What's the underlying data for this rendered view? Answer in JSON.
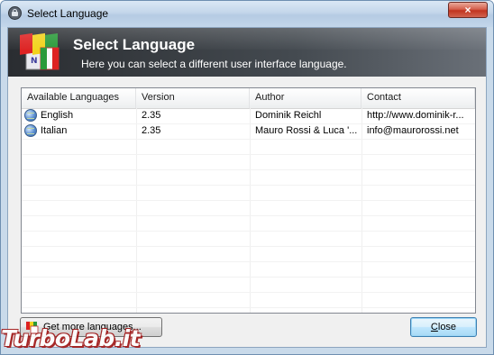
{
  "window": {
    "title": "Select Language",
    "close_glyph": "×"
  },
  "banner": {
    "title": "Select Language",
    "subtitle": "Here you can select a different user interface language.",
    "icon": "language-flags-icon"
  },
  "list": {
    "columns": [
      "Available Languages",
      "Version",
      "Author",
      "Contact"
    ],
    "rows": [
      {
        "language": "English",
        "version": "2.35",
        "author": "Dominik Reichl",
        "contact": "http://www.dominik-r...",
        "icon": "globe-icon"
      },
      {
        "language": "Italian",
        "version": "2.35",
        "author": "Mauro Rossi & Luca '...",
        "contact": "info@maurorossi.net",
        "icon": "globe-icon"
      }
    ]
  },
  "buttons": {
    "more_languages": "Get more languages...",
    "close_underlined": "C",
    "close_rest": "lose"
  },
  "watermark": "TurboLab.it",
  "colors": {
    "banner_dark": "#2a2d31",
    "close_accent": "#c1341f",
    "default_button_border": "#3c7fb1"
  }
}
